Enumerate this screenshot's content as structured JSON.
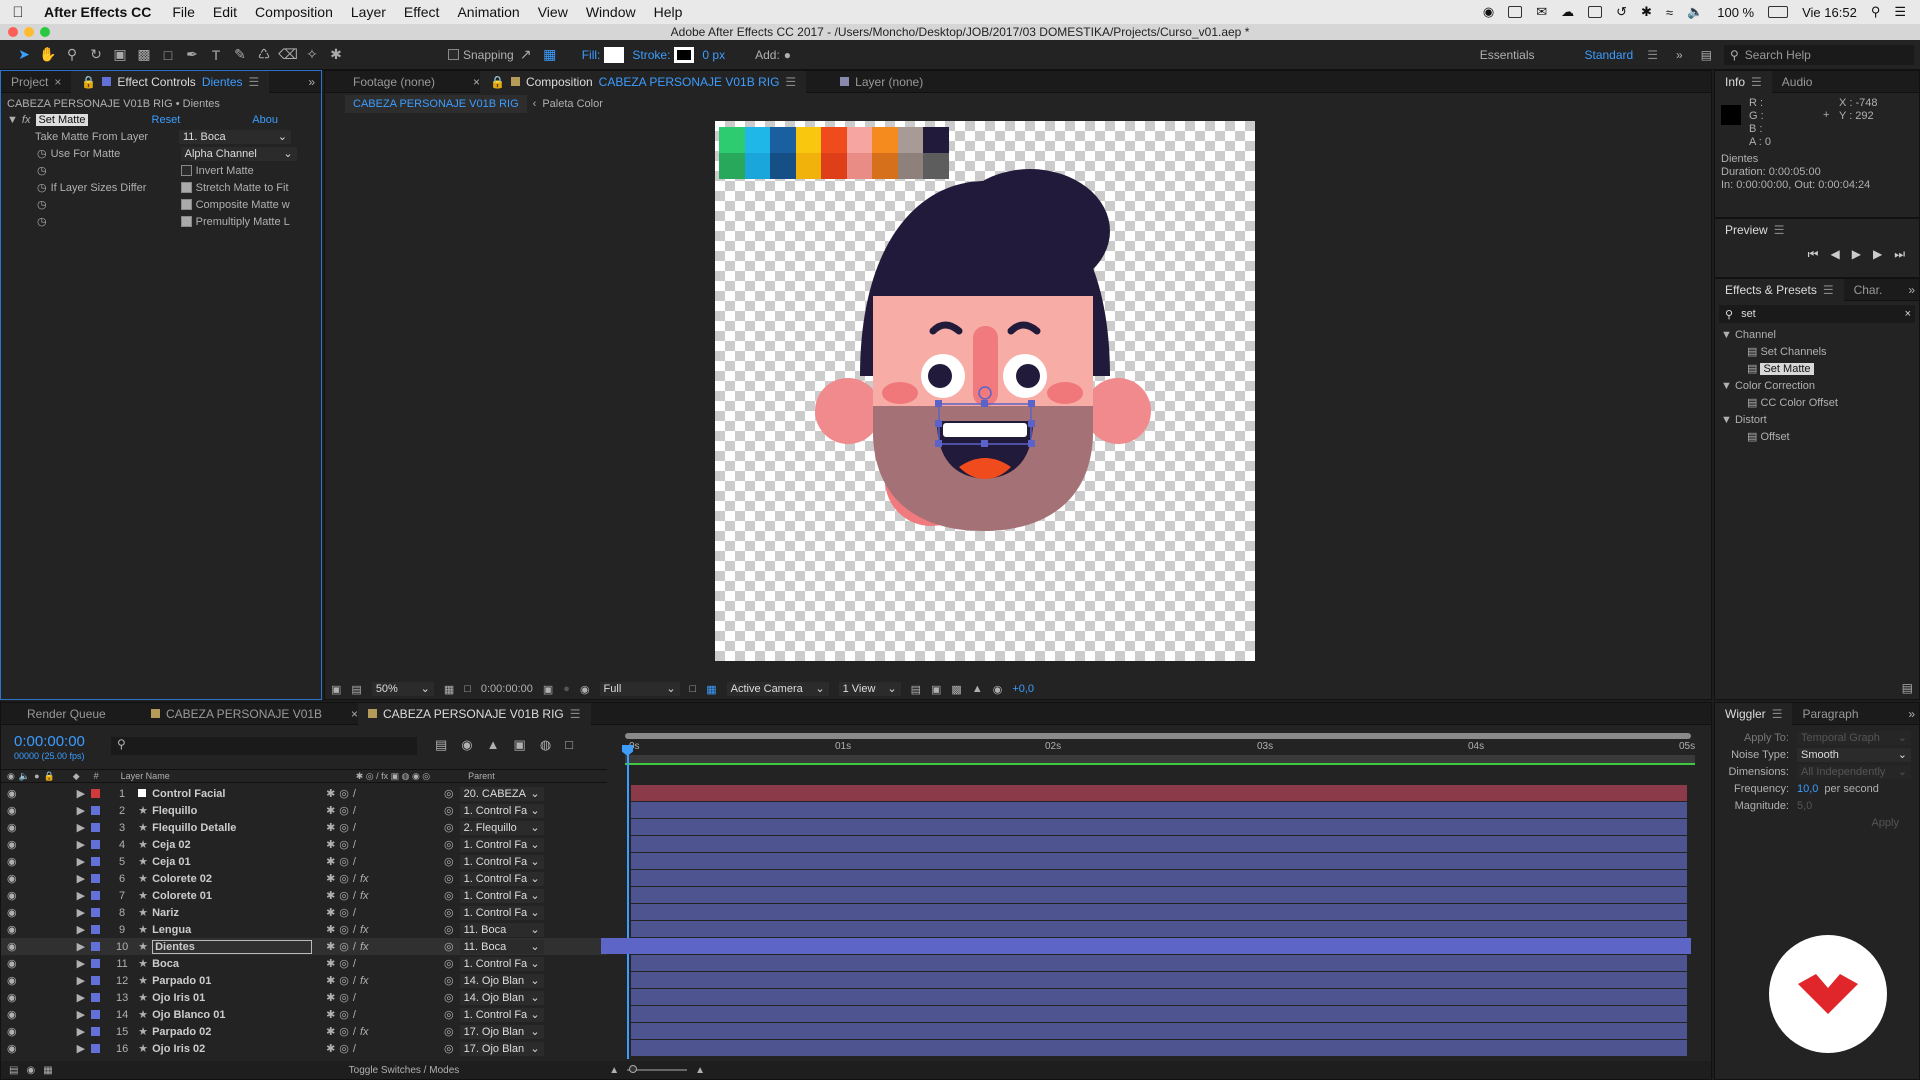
{
  "menubar": {
    "app_name": "After Effects CC",
    "menus": [
      "File",
      "Edit",
      "Composition",
      "Layer",
      "Effect",
      "Animation",
      "View",
      "Window",
      "Help"
    ],
    "battery": "100 %",
    "clock": "Vie 16:52"
  },
  "titlebar": {
    "title": "Adobe After Effects CC 2017 - /Users/Moncho/Desktop/JOB/2017/03 DOMESTIKA/Projects/Curso_v01.aep *"
  },
  "toolbar": {
    "snapping_label": "Snapping",
    "fill_label": "Fill:",
    "stroke_label": "Stroke:",
    "stroke_width": "0 px",
    "add_label": "Add:",
    "workspace_essentials": "Essentials",
    "workspace_standard": "Standard",
    "search_placeholder": "Search Help"
  },
  "left_panel": {
    "tab_project": "Project",
    "tab_effect_controls": "Effect Controls",
    "tab_effect_layer": "Dientes",
    "breadcrumb": "CABEZA PERSONAJE V01B RIG • Dientes",
    "effect_name": "Set Matte",
    "reset_label": "Reset",
    "about_label": "Abou",
    "props": {
      "take_matte_label": "Take Matte From Layer",
      "take_matte_value": "11. Boca",
      "use_for_matte_label": "Use For Matte",
      "use_for_matte_value": "Alpha Channel",
      "invert_label": "Invert Matte",
      "if_sizes_label": "If Layer Sizes Differ",
      "stretch_label": "Stretch Matte to Fit",
      "composite_label": "Composite Matte w",
      "premultiply_label": "Premultiply Matte L"
    }
  },
  "viewer": {
    "tab_footage": "Footage (none)",
    "tab_composition_prefix": "Composition",
    "tab_composition_name": "CABEZA PERSONAJE V01B RIG",
    "tab_layer": "Layer (none)",
    "crumb_active": "CABEZA PERSONAJE V01B RIG",
    "crumb_next": "Paleta Color",
    "palette_colors": [
      "#2ecc71",
      "#1fb7e8",
      "#1a5fa0",
      "#f9c80e",
      "#f04b1d",
      "#f6a5a0",
      "#f58b1e",
      "#a89a94",
      "#221a3a",
      "#27a85a",
      "#1aa5db",
      "#164f86",
      "#f2b20c",
      "#de3f18",
      "#e98c86",
      "#d6701a",
      "#8e817c",
      "#5d5d5d"
    ],
    "bottom": {
      "zoom": "50%",
      "timecode": "0:00:00:00",
      "resolution": "Full",
      "camera": "Active Camera",
      "views": "1 View",
      "exposure": "+0,0"
    }
  },
  "info_panel": {
    "tab_info": "Info",
    "tab_audio": "Audio",
    "r": "R :",
    "g": "G :",
    "b": "B :",
    "a": "A : 0",
    "x": "X : -748",
    "y": "Y : 292",
    "layer_name": "Dientes",
    "duration": "Duration: 0:00:05:00",
    "in_out": "In: 0:00:00:00, Out: 0:00:04:24"
  },
  "preview_panel": {
    "title": "Preview"
  },
  "effects_panel": {
    "tab_effects": "Effects & Presets",
    "tab_char": "Char.",
    "search_value": "set",
    "groups": [
      {
        "name": "Channel",
        "items": [
          "Set Channels",
          "Set Matte"
        ]
      },
      {
        "name": "Color Correction",
        "items": [
          "CC Color Offset"
        ]
      },
      {
        "name": "Distort",
        "items": [
          "Offset"
        ]
      }
    ]
  },
  "wiggler_panel": {
    "tab_wiggler": "Wiggler",
    "tab_paragraph": "Paragraph",
    "apply_to_label": "Apply To:",
    "apply_to_value": "Temporal Graph",
    "noise_label": "Noise Type:",
    "noise_value": "Smooth",
    "dimensions_label": "Dimensions:",
    "dimensions_value": "All Independently",
    "frequency_label": "Frequency:",
    "frequency_value": "10,0",
    "frequency_unit": "per second",
    "magnitude_label": "Magnitude:",
    "magnitude_value": "5,0",
    "apply_label": "Apply"
  },
  "timeline": {
    "tab_render": "Render Queue",
    "tab_comp1": "CABEZA PERSONAJE V01B",
    "tab_comp2": "CABEZA PERSONAJE V01B RIG",
    "timecode": "0:00:00:00",
    "frames": "00000 (25.00 fps)",
    "col_layer_name": "Layer Name",
    "col_parent": "Parent",
    "toggle_label": "Toggle Switches / Modes",
    "ruler": [
      "0s",
      "01s",
      "02s",
      "03s",
      "04s",
      "05s"
    ],
    "layers": [
      {
        "num": "1",
        "name": "Control Facial",
        "parent": "20. CABEZA",
        "color": "#d03a3a",
        "fx": false,
        "solid": true
      },
      {
        "num": "2",
        "name": "Flequillo",
        "parent": "1. Control Fa",
        "color": "#6270d8",
        "fx": false
      },
      {
        "num": "3",
        "name": "Flequillo Detalle",
        "parent": "2. Flequillo",
        "color": "#6270d8",
        "fx": false
      },
      {
        "num": "4",
        "name": "Ceja 02",
        "parent": "1. Control Fa",
        "color": "#6270d8",
        "fx": false
      },
      {
        "num": "5",
        "name": "Ceja 01",
        "parent": "1. Control Fa",
        "color": "#6270d8",
        "fx": false
      },
      {
        "num": "6",
        "name": "Colorete 02",
        "parent": "1. Control Fa",
        "color": "#6270d8",
        "fx": true
      },
      {
        "num": "7",
        "name": "Colorete 01",
        "parent": "1. Control Fa",
        "color": "#6270d8",
        "fx": true
      },
      {
        "num": "8",
        "name": "Nariz",
        "parent": "1. Control Fa",
        "color": "#6270d8",
        "fx": false
      },
      {
        "num": "9",
        "name": "Lengua",
        "parent": "11. Boca",
        "color": "#6270d8",
        "fx": true
      },
      {
        "num": "10",
        "name": "Dientes",
        "parent": "11. Boca",
        "color": "#6270d8",
        "fx": true,
        "selected": true
      },
      {
        "num": "11",
        "name": "Boca",
        "parent": "1. Control Fa",
        "color": "#6270d8",
        "fx": false
      },
      {
        "num": "12",
        "name": "Parpado 01",
        "parent": "14. Ojo Blan",
        "color": "#6270d8",
        "fx": true
      },
      {
        "num": "13",
        "name": "Ojo Iris 01",
        "parent": "14. Ojo Blan",
        "color": "#6270d8",
        "fx": false
      },
      {
        "num": "14",
        "name": "Ojo Blanco 01",
        "parent": "1. Control Fa",
        "color": "#6270d8",
        "fx": false
      },
      {
        "num": "15",
        "name": "Parpado 02",
        "parent": "17. Ojo Blan",
        "color": "#6270d8",
        "fx": true
      },
      {
        "num": "16",
        "name": "Ojo Iris 02",
        "parent": "17. Ojo Blan",
        "color": "#6270d8",
        "fx": false
      }
    ]
  },
  "colors": {
    "accent": "#3c9dff",
    "selection": "#5d66c7",
    "layer_bar": "#4e5490",
    "solid_bar": "#8a3a48",
    "logo_red": "#e0262a"
  }
}
